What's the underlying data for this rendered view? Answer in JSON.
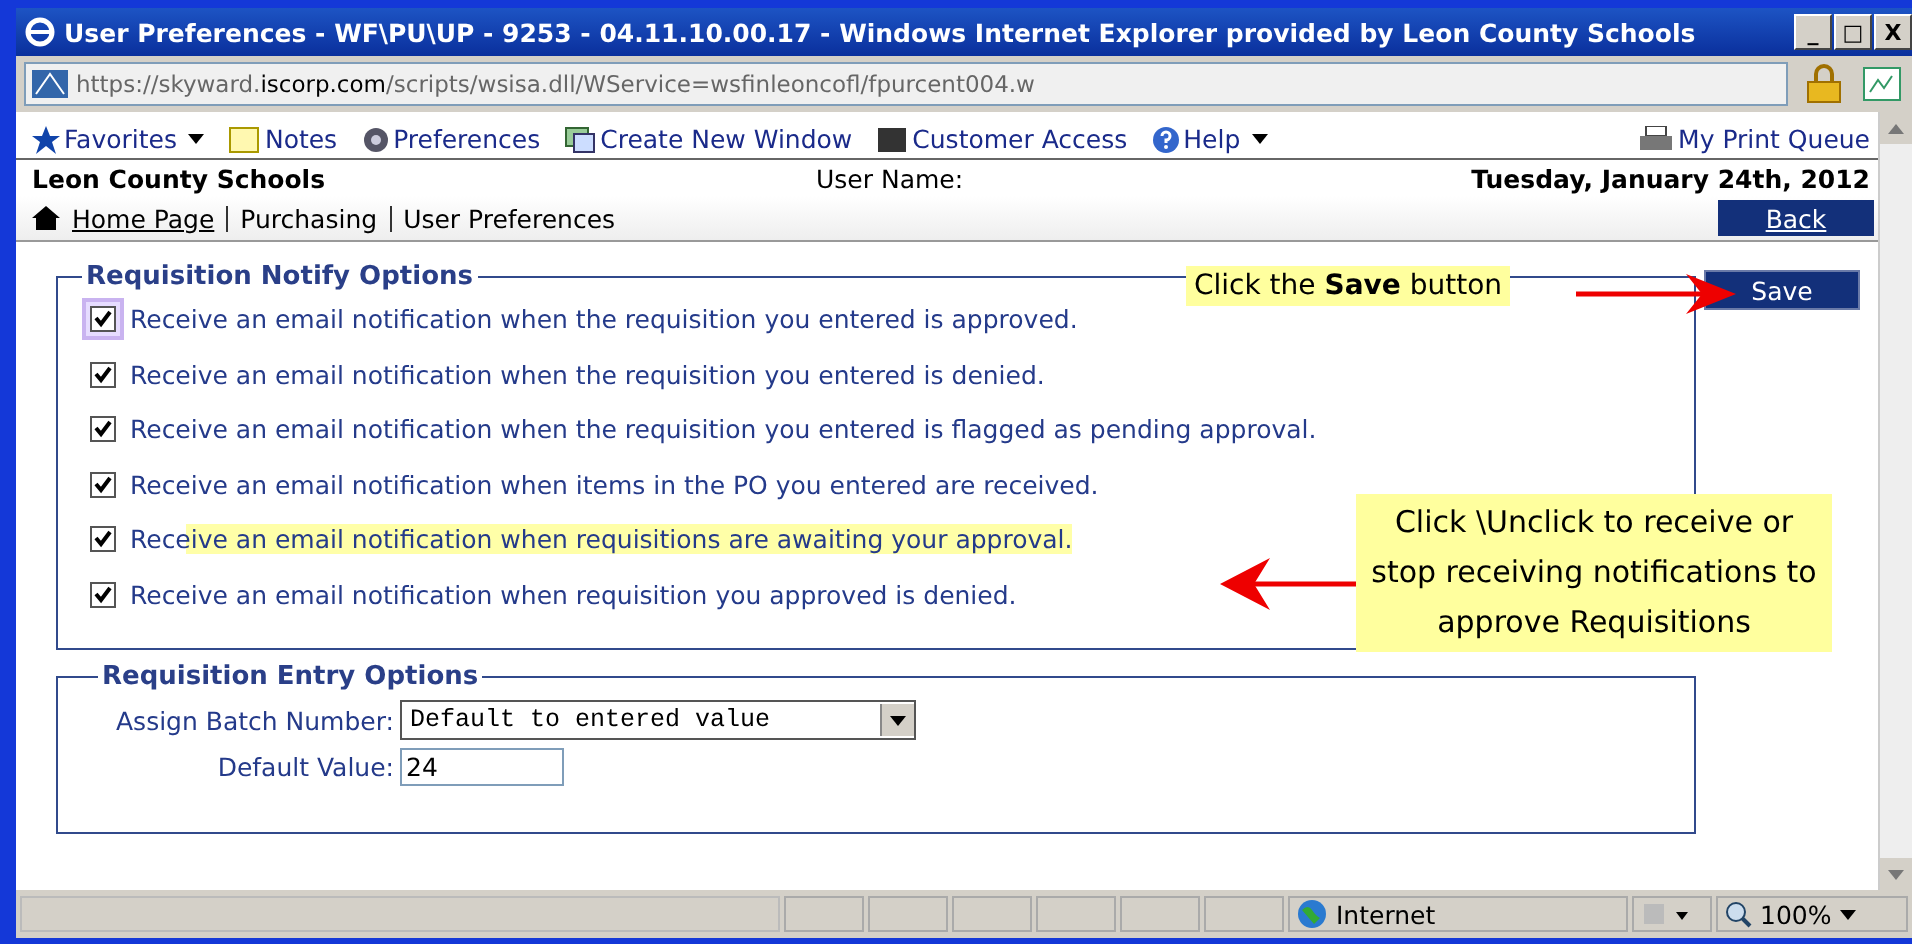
{
  "window": {
    "title": "User Preferences - WF\\PU\\UP - 9253 - 04.11.10.00.17 - Windows Internet Explorer provided by Leon County Schools",
    "controls": [
      "_",
      "□",
      "X"
    ]
  },
  "address_bar": {
    "url_prefix": "https://skyward.",
    "url_domain": "iscorp.com",
    "url_rest": "/scripts/wsisa.dll/WService=wsfinleoncofl/fpurcent004.w"
  },
  "toolbar": {
    "items": [
      {
        "label": "Favorites",
        "kind": "star",
        "dropdown": true
      },
      {
        "label": "Notes",
        "kind": "note",
        "dropdown": false
      },
      {
        "label": "Preferences",
        "kind": "gear",
        "dropdown": false
      },
      {
        "label": "Create New Window",
        "kind": "window",
        "dropdown": false
      },
      {
        "label": "Customer Access",
        "kind": "monitor",
        "dropdown": false
      },
      {
        "label": "Help",
        "kind": "help",
        "dropdown": true
      }
    ],
    "print_queue": "My Print Queue"
  },
  "header": {
    "organization": "Leon County Schools",
    "user_label": "User Name:",
    "date": "Tuesday, January 24th, 2012"
  },
  "breadcrumb": {
    "items": [
      "Home Page",
      "Purchasing",
      "User Preferences"
    ],
    "back": "Back"
  },
  "notify_options": {
    "title": "Requisition Notify Options",
    "save": "Save",
    "items": [
      {
        "label": "Receive an email notification when the requisition you entered is approved.",
        "checked": true,
        "focused": true,
        "highlighted": false
      },
      {
        "label": "Receive an email notification when the requisition you entered is denied.",
        "checked": true,
        "focused": false,
        "highlighted": false
      },
      {
        "label": "Receive an email notification when the requisition you entered is flagged as pending approval.",
        "checked": true,
        "focused": false,
        "highlighted": false
      },
      {
        "label": "Receive an email notification when items in the PO you entered are received.",
        "checked": true,
        "focused": false,
        "highlighted": false
      },
      {
        "label": "Receive an email notification when requisitions are awaiting your approval.",
        "checked": true,
        "focused": false,
        "highlighted": true
      },
      {
        "label": "Receive an email notification when requisition you approved is denied.",
        "checked": true,
        "focused": false,
        "highlighted": false
      }
    ]
  },
  "entry_options": {
    "title": "Requisition Entry Options",
    "batch_label": "Assign Batch Number:",
    "batch_value": "Default to entered value",
    "default_label": "Default Value:",
    "default_value": "24"
  },
  "annotations": [
    {
      "kind": "save",
      "text": "Click the **Save** button"
    },
    {
      "kind": "checkbox",
      "text": "Click \\Unclick to receive or stop receiving notifications to approve Requisitions"
    }
  ],
  "status_bar": {
    "zone": "Internet",
    "zoom": "100%"
  }
}
